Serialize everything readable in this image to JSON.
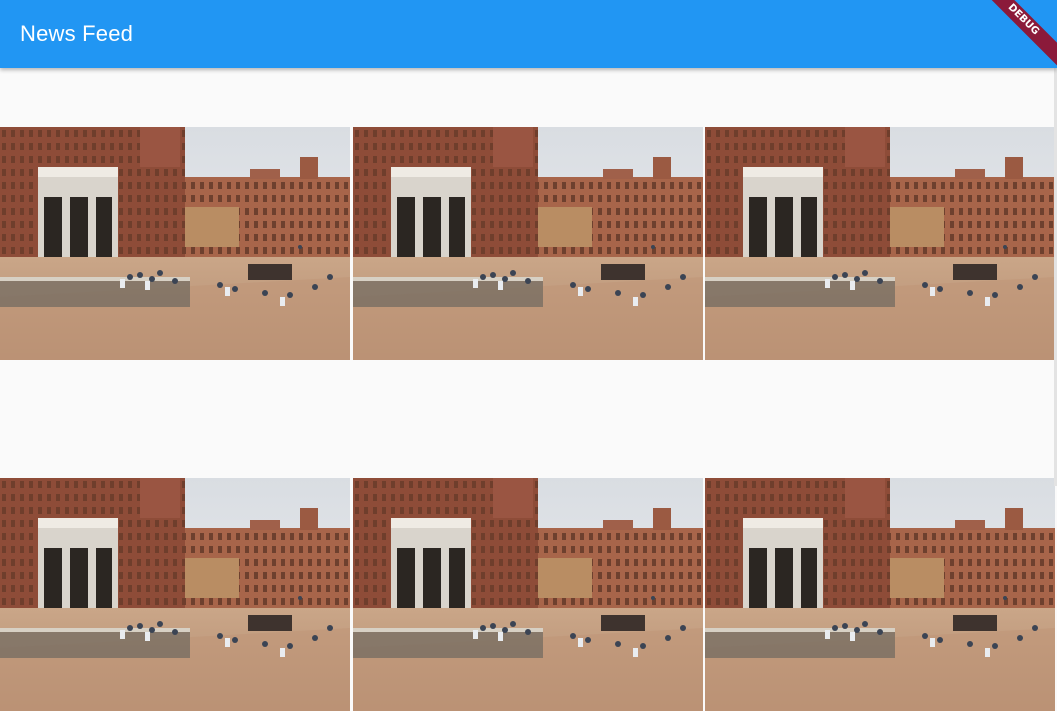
{
  "app_bar": {
    "title": "News Feed"
  },
  "debug_banner": {
    "label": "DEBUG"
  },
  "feed": {
    "rows": [
      {
        "images": [
          "piazza-photo",
          "piazza-photo",
          "piazza-photo"
        ]
      },
      {
        "images": [
          "piazza-photo",
          "piazza-photo",
          "piazza-photo"
        ]
      }
    ]
  },
  "colors": {
    "app_bar": "#2196f3",
    "background": "#fafafa",
    "banner": "#8b1a3a"
  }
}
